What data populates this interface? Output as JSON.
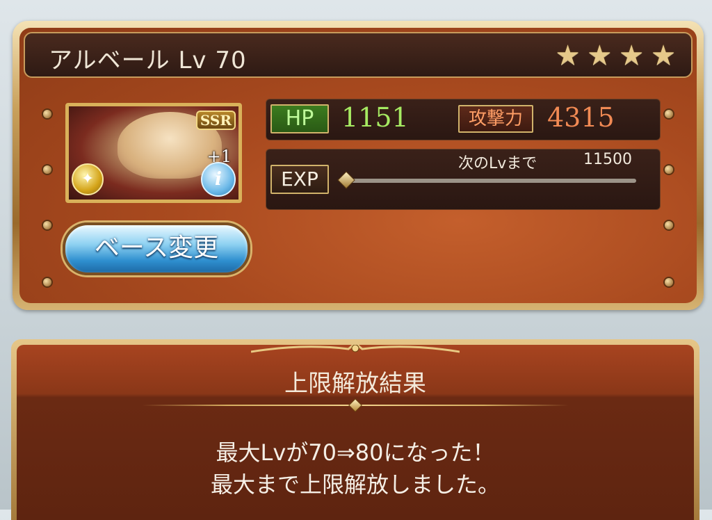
{
  "character": {
    "name_level": "アルベール Lv 70",
    "stars": [
      "★",
      "★",
      "★",
      "★"
    ],
    "rarity": "SSR",
    "plus_bonus": "+1",
    "element_icon": "wind-element-icon",
    "info_icon": "info-icon"
  },
  "buttons": {
    "change_base": "ベース変更"
  },
  "stats": {
    "hp_label": "HP",
    "hp_value": "1151",
    "atk_label": "攻撃力",
    "atk_value": "4315",
    "exp_label": "EXP",
    "next_level_label": "次のLvまで",
    "next_level_value": "11500",
    "exp_progress": 0
  },
  "result": {
    "title": "上限解放結果",
    "line1": "最大Lvが70⇒80になった！",
    "line2": "最大まで上限解放しました。"
  },
  "colors": {
    "panel_orange": "#a94a1f",
    "frame_gold": "#c9a15c",
    "hp_green": "#a6ea62",
    "atk_orange": "#f18a54",
    "button_blue": "#2f8fcf"
  }
}
